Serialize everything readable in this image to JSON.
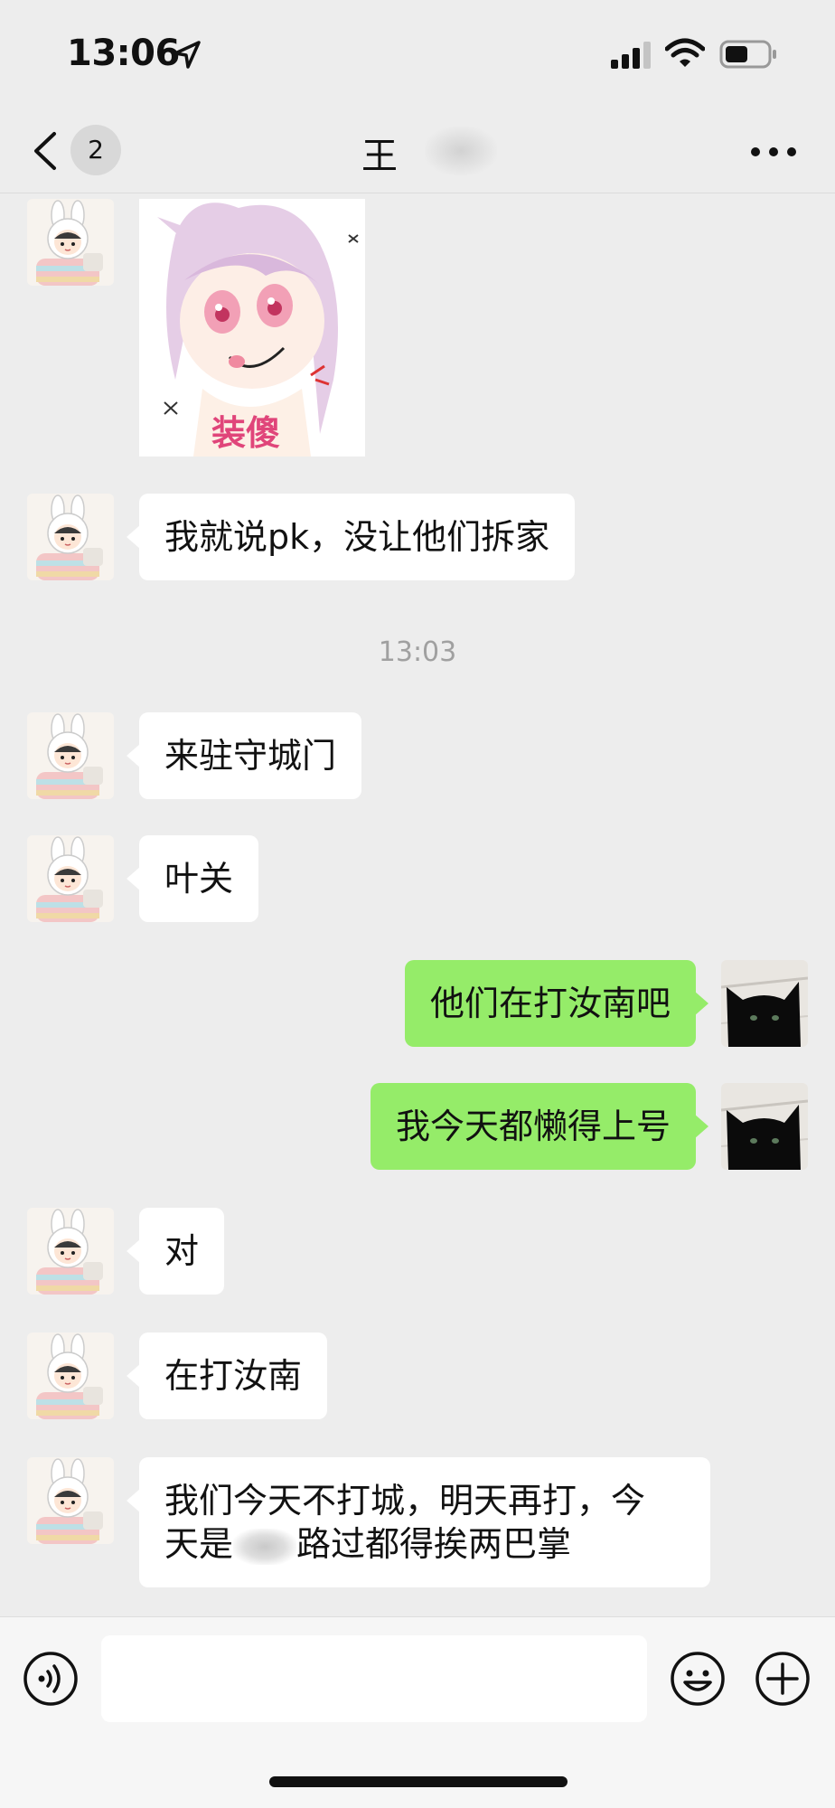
{
  "status_bar": {
    "time": "13:06"
  },
  "nav": {
    "unread_count": "2",
    "title": "王",
    "more_icon": "more-dots-icon"
  },
  "sticker": {
    "caption": "装傻"
  },
  "timestamp": "13:03",
  "messages": [
    {
      "side": "left",
      "text": "我就说pk，没让他们拆家"
    },
    {
      "side": "left",
      "text": "来驻守城门"
    },
    {
      "side": "left",
      "text": "叶关"
    },
    {
      "side": "right",
      "text": "他们在打汝南吧"
    },
    {
      "side": "right",
      "text": "我今天都懒得上号"
    },
    {
      "side": "left",
      "text": "对"
    },
    {
      "side": "left",
      "text": "在打汝南"
    },
    {
      "side": "left",
      "line1": "我们今天不打城，明天再打，今",
      "line2_a": "天是",
      "line2_b": "路过都得挨两巴掌"
    }
  ],
  "colors": {
    "background": "#ededed",
    "bubble_self": "#95ec69",
    "bubble_other": "#ffffff",
    "timestamp": "#a0a0a0"
  }
}
